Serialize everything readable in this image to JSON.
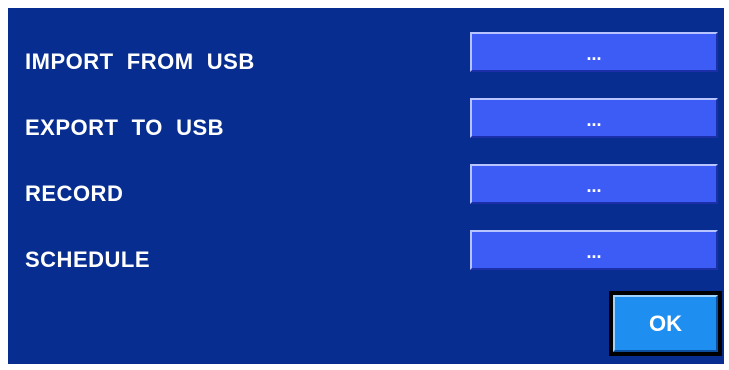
{
  "colors": {
    "panel_background": "#062d8f",
    "row_button": "#3c5cf5",
    "ok_button": "#1e8ef0",
    "text": "#ffffff"
  },
  "rows": [
    {
      "label": "IMPORT  FROM  USB",
      "button_label": "..."
    },
    {
      "label": "EXPORT  TO  USB",
      "button_label": "..."
    },
    {
      "label": "RECORD",
      "button_label": "..."
    },
    {
      "label": "SCHEDULE",
      "button_label": "..."
    }
  ],
  "ok_button": {
    "label": "OK"
  }
}
